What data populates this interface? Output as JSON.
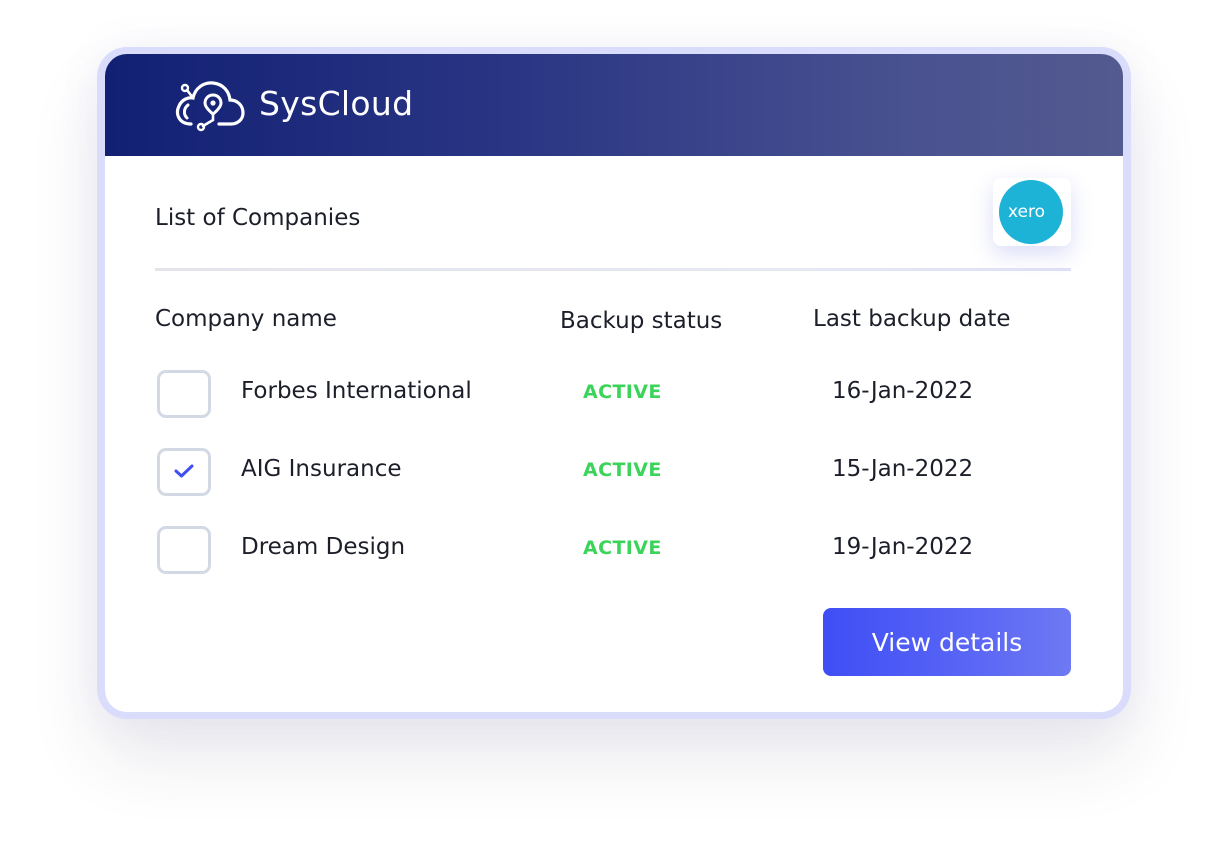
{
  "header": {
    "brand_name": "SysCloud",
    "logo_icon": "cloud-circuit-icon"
  },
  "panel": {
    "title": "List of Companies",
    "integration_logo_text": "xero"
  },
  "table": {
    "columns": [
      "Company name",
      "Backup status",
      "Last backup date"
    ],
    "rows": [
      {
        "company": "Forbes International",
        "status": "ACTIVE",
        "date": "16-Jan-2022",
        "checked": false
      },
      {
        "company": "AIG Insurance",
        "status": "ACTIVE",
        "date": "15-Jan-2022",
        "checked": true
      },
      {
        "company": "Dream Design",
        "status": "ACTIVE",
        "date": "19-Jan-2022",
        "checked": false
      }
    ]
  },
  "actions": {
    "view_details_label": "View details"
  },
  "colors": {
    "header_start": "#122074",
    "status_active": "#3bd45a",
    "button": "#4a57f5",
    "xero_blue": "#1db3d7",
    "check": "#3f4ef5"
  }
}
